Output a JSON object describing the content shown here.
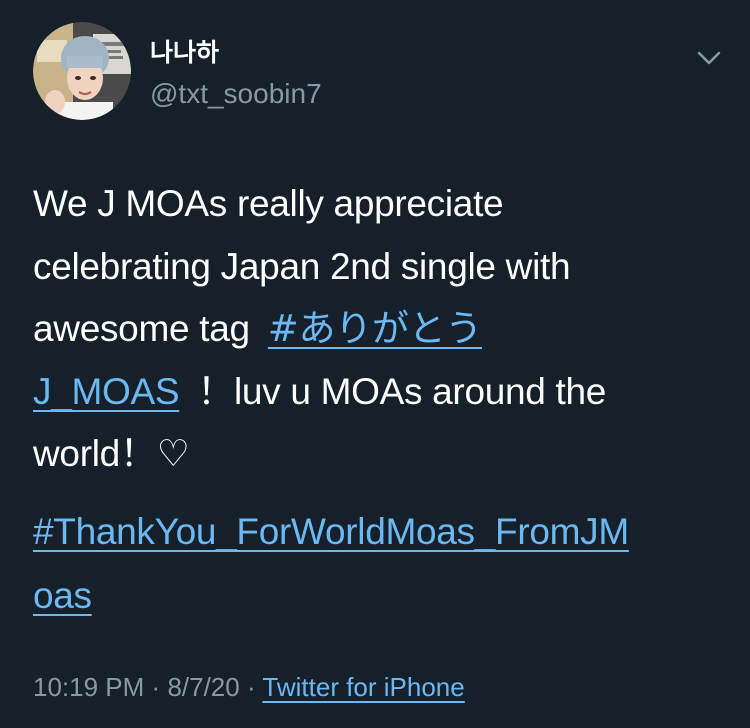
{
  "user": {
    "display_name": "나나하",
    "handle": "@txt_soobin7"
  },
  "tweet": {
    "line1": "We J MOAs really appreciate",
    "line2": "celebrating Japan 2nd single with",
    "line3_text": "awesome tag",
    "hashtag1_part1": "#ありがとう",
    "hashtag1_part2": "J_MOAS",
    "line4_rest": "！luv u MOAs around the",
    "line5": "world！♡",
    "hashtag2_part1": "#ThankYou_ForWorldMoas_FromJM",
    "hashtag2_part2": "oas"
  },
  "meta": {
    "time": "10:19 PM",
    "sep1": "·",
    "date": "8/7/20",
    "sep2": "·",
    "source": "Twitter for iPhone"
  },
  "icons": {
    "menu": "chevron-down-icon",
    "avatar": "profile-photo"
  },
  "colors": {
    "background": "#15202b",
    "link": "#6cb8f2",
    "secondary_text": "#8899a6"
  }
}
